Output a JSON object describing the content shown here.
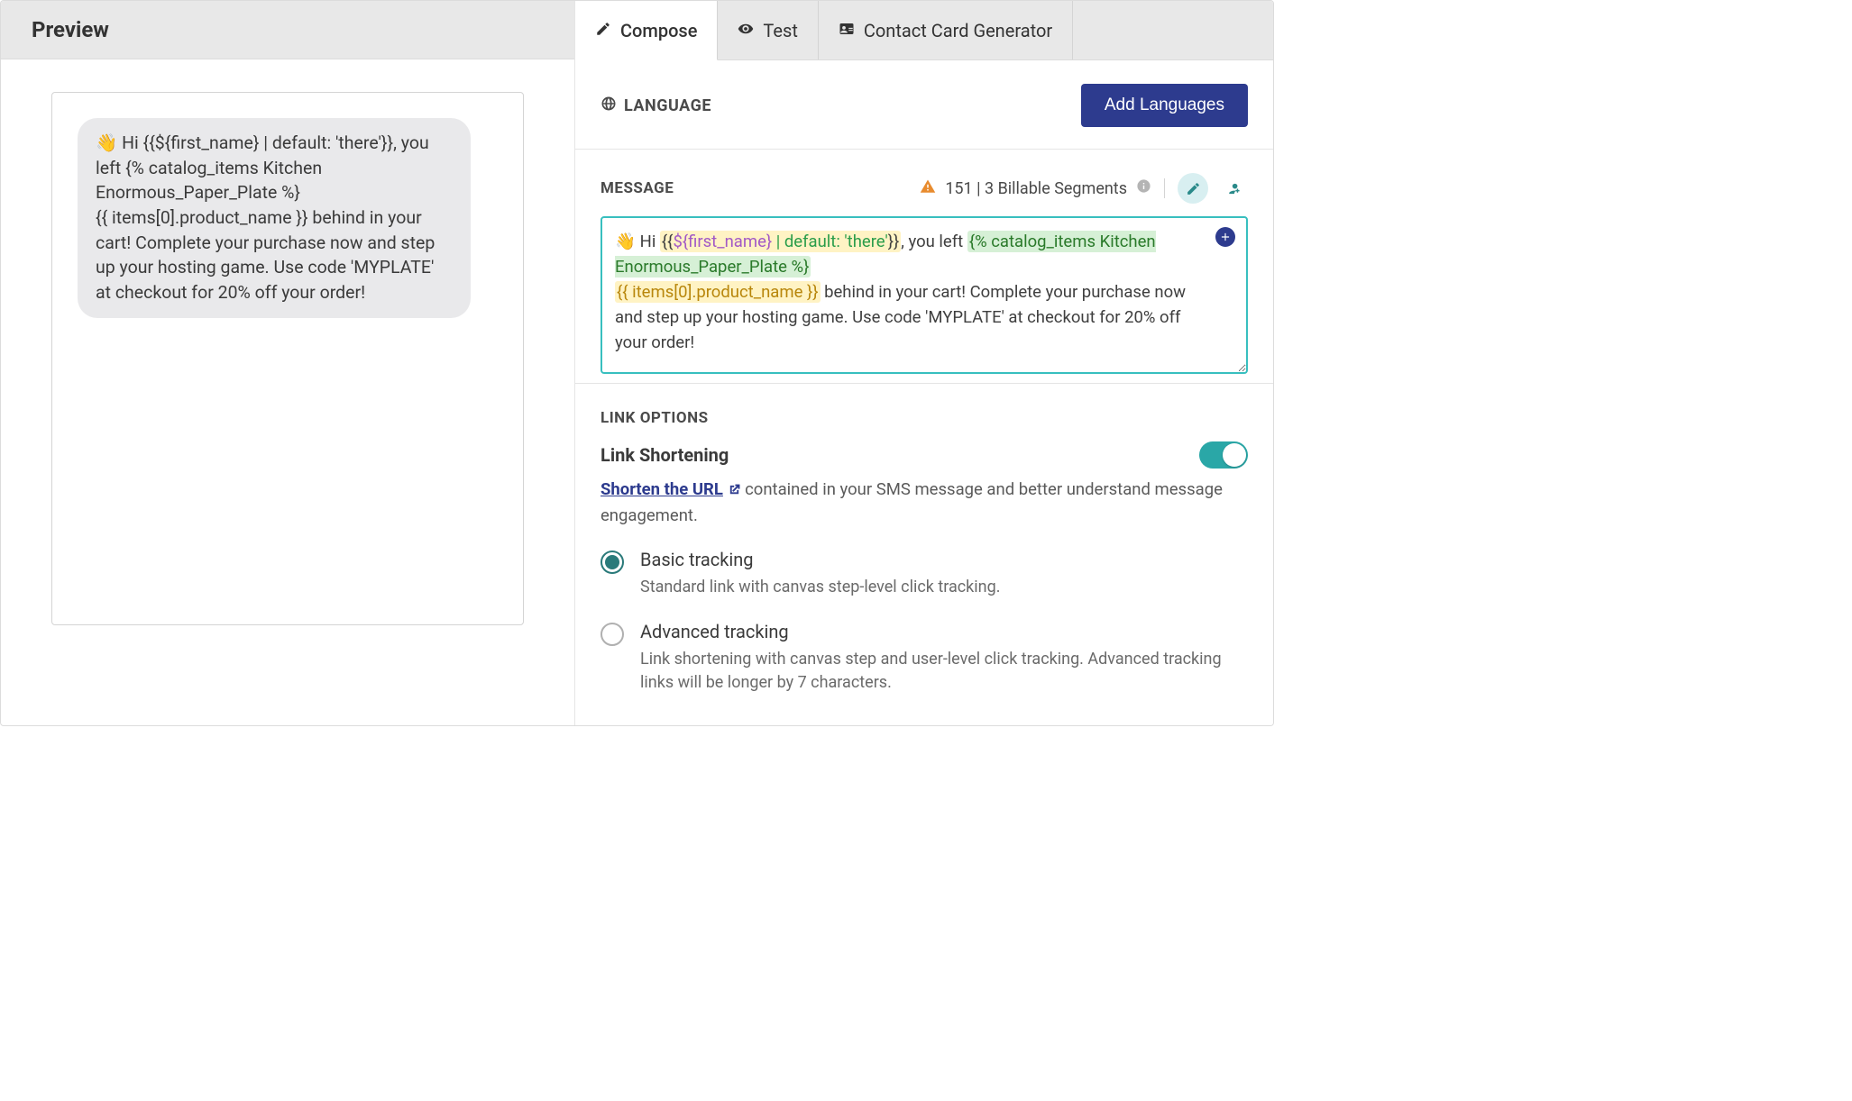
{
  "preview": {
    "title": "Preview",
    "bubble_lines": [
      "👋 Hi {{${first_name} | default: 'there'}}, you left {% catalog_items Kitchen Enormous_Paper_Plate %}",
      "{{ items[0].product_name }} behind in your cart! Complete your purchase now and step up your hosting game. Use code 'MYPLATE' at checkout for 20% off your order!"
    ]
  },
  "tabs": {
    "compose": "Compose",
    "test": "Test",
    "contact": "Contact Card Generator",
    "active": "compose"
  },
  "language": {
    "label": "LANGUAGE",
    "button": "Add Languages"
  },
  "message": {
    "label": "MESSAGE",
    "count": "151 | 3 Billable Segments",
    "segments": {
      "greet_prefix": "👋 Hi ",
      "var_open": "{{",
      "first_name": "${first_name}",
      "default": " | default: 'there'",
      "var_close": "}}",
      "after_greet": ", you left ",
      "catalog": "{% catalog_items Kitchen Enormous_Paper_Plate %}",
      "item": "{{ items[0].product_name }}",
      "tail": " behind in your cart! Complete your purchase now and step up your hosting game. Use code 'MYPLATE' at checkout for 20% off your order!"
    }
  },
  "link_options": {
    "label": "LINK OPTIONS",
    "shortening_title": "Link Shortening",
    "shorten_link_text": "Shorten the URL",
    "desc_tail": " contained in your SMS message and better understand message engagement.",
    "toggle_on": true,
    "basic": {
      "title": "Basic tracking",
      "sub": "Standard link with canvas step-level click tracking.",
      "selected": true
    },
    "advanced": {
      "title": "Advanced tracking",
      "sub": "Link shortening with canvas step and user-level click tracking. Advanced tracking links will be longer by 7 characters.",
      "selected": false
    }
  }
}
